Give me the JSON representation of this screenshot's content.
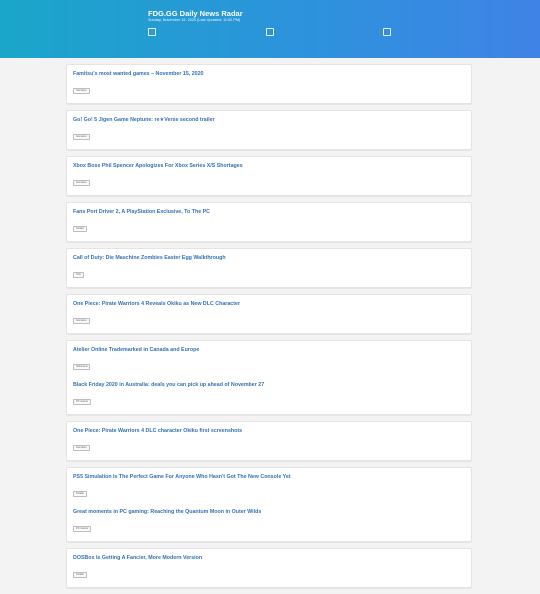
{
  "header": {
    "title": "FDG.GG Daily News Radar",
    "subtitle": "Sunday, November 15, 2020 (Last Updated: 11:52 PM)"
  },
  "cards": [
    {
      "items": [
        {
          "title": "Famitsu's most wanted games – November 15, 2020",
          "source": "Gematsu"
        }
      ]
    },
    {
      "items": [
        {
          "title": "Go! Go! 5 Jigen Game Neptune: re★Verse second trailer",
          "source": "Gematsu"
        }
      ]
    },
    {
      "items": [
        {
          "title": "Xbox Boss Phil Spencer Apologizes For Xbox Series X/S Shortages",
          "source": "Gematsu"
        }
      ]
    },
    {
      "items": [
        {
          "title": "Fans Port Driver 2, A PlayStation Exclusive, To The PC",
          "source": "Kotaku"
        }
      ]
    },
    {
      "items": [
        {
          "title": "Call of Duty: Die Maschine Zombies Easter Egg Walkthrough",
          "source": "IGN"
        }
      ]
    },
    {
      "items": [
        {
          "title": "One Piece: Pirate Warriors 4 Reveals Okiku as New DLC Character",
          "source": "Gematsu"
        }
      ]
    },
    {
      "items": [
        {
          "title": "Atelier Online Trademarked in Canada and Europe",
          "source": "Siliconera"
        },
        {
          "title": "Black Friday 2020 in Australia: deals you can pick up ahead of November 27",
          "source": "PC Gamer"
        }
      ]
    },
    {
      "items": [
        {
          "title": "One Piece: Pirate Warriors 4 DLC character Okiku first screenshots",
          "source": "Gematsu"
        }
      ]
    },
    {
      "items": [
        {
          "title": "PS5 Simulation Is The Perfect Game For Anyone Who Hasn't Got The New Console Yet",
          "source": "Kotaku"
        },
        {
          "title": "Great moments in PC gaming: Reaching the Quantum Moon in Outer Wilds",
          "source": "PC Gamer"
        }
      ]
    },
    {
      "items": [
        {
          "title": "DOSBox Is Getting A Fancier, More Modern Version",
          "source": "Kotaku"
        }
      ]
    }
  ]
}
